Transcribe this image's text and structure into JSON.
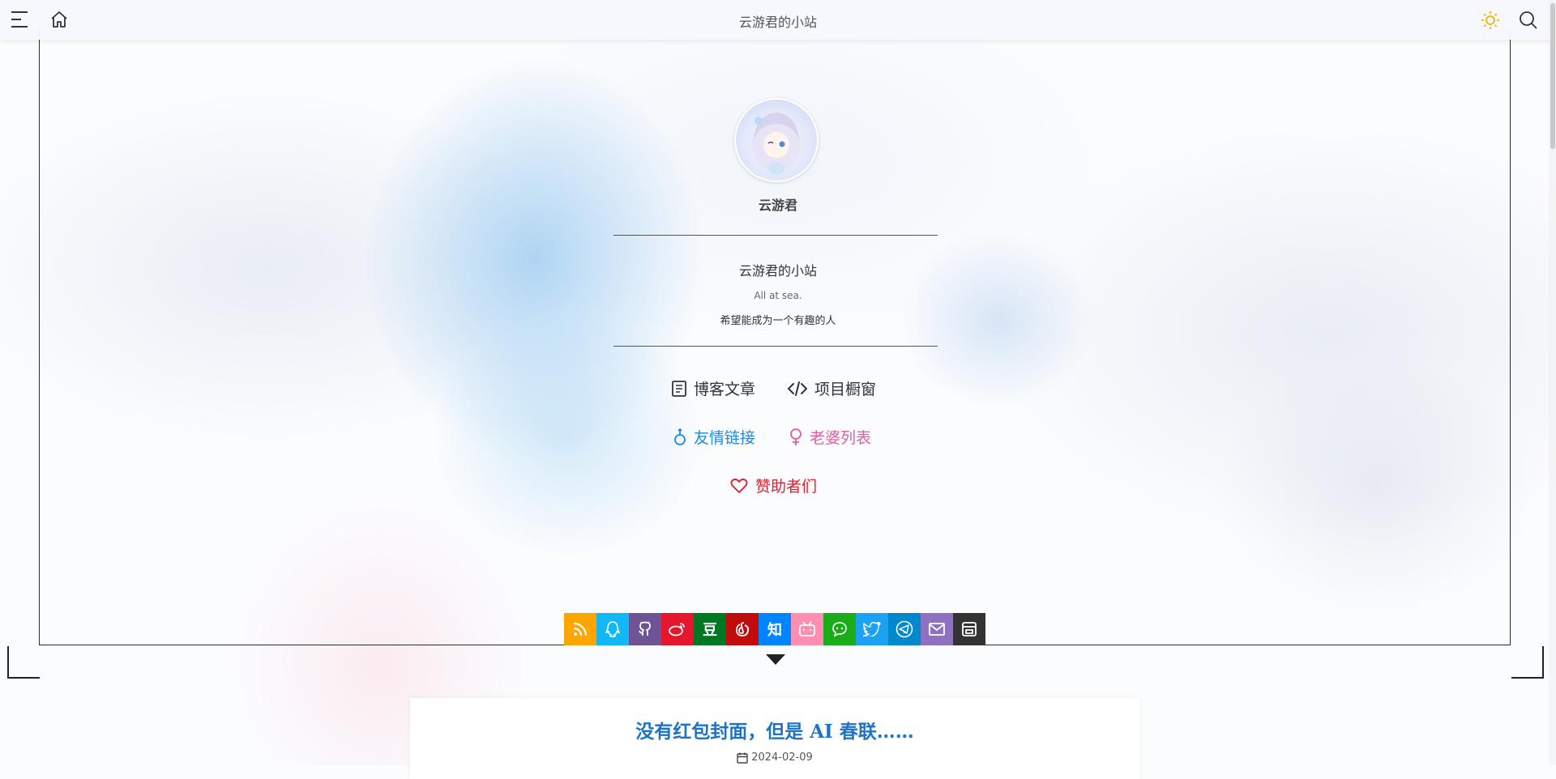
{
  "topbar": {
    "title": "云游君的小站",
    "icons": [
      "menu-icon",
      "home-icon",
      "sun-icon",
      "search-icon"
    ]
  },
  "profile": {
    "author": "云游君",
    "site_name": "云游君的小站",
    "subtitle": "All at sea.",
    "motto": "希望能成为一个有趣的人"
  },
  "menu": {
    "posts": "博客文章",
    "projects": "项目橱窗",
    "links": "友情链接",
    "girls": "老婆列表",
    "sponsors": "赞助者们"
  },
  "colors": {
    "menu_default": "#333333",
    "links": "#1e88e5",
    "girls": "#e05ba3",
    "sponsors": "#e11d2e",
    "post_title": "#1d74c4",
    "sun": "#f4b400"
  },
  "socials": [
    {
      "name": "rss",
      "color": "#ffa500",
      "glyph": ""
    },
    {
      "name": "qq",
      "color": "#12b7f5",
      "glyph": ""
    },
    {
      "name": "github",
      "color": "#6e5494",
      "glyph": ""
    },
    {
      "name": "weibo",
      "color": "#e6162d",
      "glyph": ""
    },
    {
      "name": "douban",
      "color": "#007722",
      "glyph": "豆"
    },
    {
      "name": "netease-music",
      "color": "#c20c0c",
      "glyph": ""
    },
    {
      "name": "zhihu",
      "color": "#0084ff",
      "glyph": "知"
    },
    {
      "name": "bilibili",
      "color": "#ff8eb3",
      "glyph": ""
    },
    {
      "name": "wechat",
      "color": "#1aad19",
      "glyph": ""
    },
    {
      "name": "twitter",
      "color": "#1da1f2",
      "glyph": ""
    },
    {
      "name": "telegram",
      "color": "#0088cc",
      "glyph": ""
    },
    {
      "name": "email",
      "color": "#8e71c1",
      "glyph": ""
    },
    {
      "name": "travelling",
      "color": "#333333",
      "glyph": ""
    }
  ],
  "post": {
    "title": "没有红包封面，但是 AI 春联……",
    "date": "2024-02-09"
  }
}
